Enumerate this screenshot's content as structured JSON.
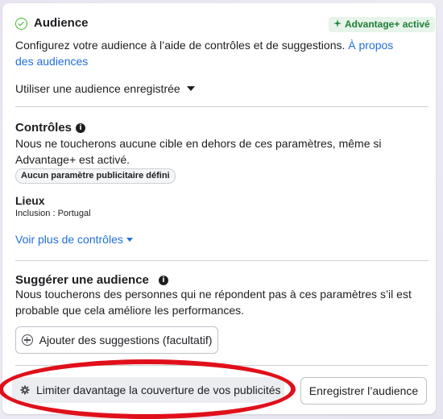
{
  "audience": {
    "title": "Audience",
    "badge": "Advantage+ activé",
    "description": "Configurez votre audience à l’aide de contrôles et de suggestions.",
    "about_link": "À propos des audiences",
    "saved_audience_dropdown": "Utiliser une audience enregistrée"
  },
  "controls": {
    "title": "Contrôles",
    "info_glyph": "i",
    "description": "Nous ne toucherons aucune cible en dehors de ces paramètres, même si Advantage+ est activé.",
    "pill": "Aucun paramètre publicitaire défini",
    "locations_label": "Lieux",
    "locations_value": "Inclusion : Portugal",
    "more_link": "Voir plus de contrôles"
  },
  "suggest": {
    "title": "Suggérer une audience",
    "info_glyph": "i",
    "description": "Nous toucherons des personnes qui ne répondent pas à ces paramètres s’il est probable que cela améliore les performances.",
    "add_button": "Ajouter des suggestions (facultatif)"
  },
  "footer": {
    "limit_button": "Limiter davantage la couverture de vos publicités",
    "save_button": "Enregistrer l’audience"
  },
  "colors": {
    "accent_link": "#216fdb",
    "advantage_green": "#42b72a",
    "highlight_red": "#e0101a"
  },
  "icons": {
    "audience_check": "check-circle-icon",
    "sparkle": "sparkle-icon",
    "gear": "gear-icon",
    "plus": "plus-circle-icon"
  }
}
